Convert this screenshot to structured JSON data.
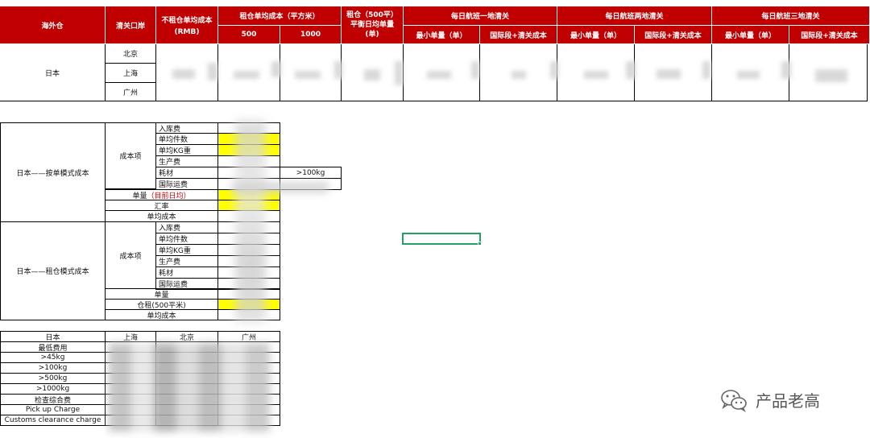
{
  "header": {
    "overseas_warehouse": "海外仓",
    "clearance_port": "清关口岸",
    "cost_no_rent": "不租仓单均成本",
    "cost_no_rent_unit": "(RMB)",
    "rent_unit_cost": "租仓单均成本（平方米）",
    "area_500": "500",
    "area_1000": "1000",
    "rent_breakeven_1": "租仓（500平）",
    "rent_breakeven_2": "平衡日均单量",
    "rent_breakeven_3": "(单)",
    "flight_one": "每日航班一地清关",
    "flight_two": "每日航班两地清关",
    "flight_three": "每日航班三地清关",
    "min_orders": "最小单量（单）",
    "intl_clearance_cost": "国际段+清关成本"
  },
  "top_table": {
    "country": "日本",
    "ports": [
      "北京",
      "上海",
      "广州"
    ]
  },
  "mid_table1": {
    "title": "日本——按单模式成本",
    "cost_items_label": "成本项",
    "items": [
      "入库费",
      "单均件数",
      "单均KG重",
      "生产费",
      "耗材",
      "国际运费"
    ],
    "consumable_note": ">100kg",
    "order_volume": "单量",
    "order_volume_note": "（目前日均）",
    "fx_rate": "汇率",
    "unit_cost": "单均成本"
  },
  "mid_table2": {
    "title": "日本——租仓模式成本",
    "cost_items_label": "成本项",
    "items": [
      "入库费",
      "单均件数",
      "单均KG重",
      "生产费",
      "耗材",
      "国际运费"
    ],
    "order_volume": "单量",
    "warehouse_rent": "仓租(500平米)",
    "unit_cost": "单均成本"
  },
  "bottom_table": {
    "headers": [
      "日本",
      "上海",
      "北京",
      "广州"
    ],
    "rows": [
      "最低费用",
      ">45kg",
      ">100kg",
      ">500kg",
      ">1000kg",
      "检查综合费",
      "Pick up Charge",
      "Customs clearance charge"
    ]
  },
  "watermark": {
    "text": "产品老高",
    "icon": "wechat-icon"
  },
  "colors": {
    "header_red": "#c00000",
    "highlight_yellow": "#ffff00",
    "selection_green": "#21a366"
  }
}
